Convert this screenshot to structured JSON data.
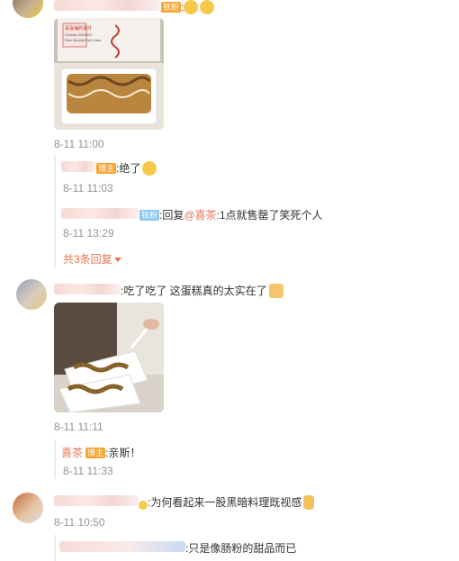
{
  "comments": [
    {
      "badge": "铁粉",
      "image_label_1": "喜喜铺的事件",
      "image_label_2": "Contain 3000000",
      "image_label_3": "Rice Noodle Roll Cake",
      "time": "8-11 11:00",
      "replies": [
        {
          "badge": "博主",
          "text": ":绝了",
          "time": "8-11 11:03"
        },
        {
          "badge": "铁粉",
          "prefix": ":回复",
          "mention": "@喜茶",
          "text": ":1点就售罄了笑死个人",
          "time": "8-11 13:29"
        }
      ],
      "more_replies": "共3条回复"
    },
    {
      "text": ":吃了吃了 这蛋糕真的太实在了",
      "time": "8-11 11:11",
      "replies": [
        {
          "author": "喜茶",
          "badge": "博主",
          "text": ":亲斯！",
          "time": "8-11 11:33"
        }
      ]
    },
    {
      "text": ":为何看起来一股黑暗料理既视感",
      "time": "8-11 10:50",
      "replies": [
        {
          "text": ":只是像肠粉的甜品而已"
        }
      ]
    }
  ],
  "colors": {
    "accent": "#eb7350",
    "muted": "#939393",
    "badge_orange": "#f7a431",
    "badge_blue": "#8cc4f5"
  }
}
